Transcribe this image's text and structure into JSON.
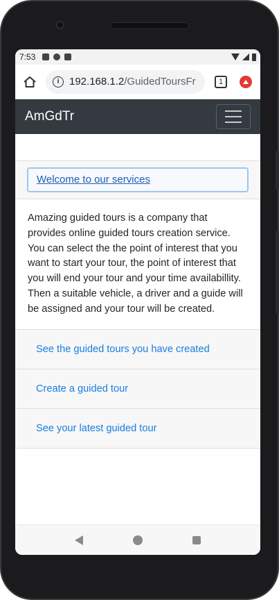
{
  "status_bar": {
    "time": "7:53"
  },
  "browser": {
    "url_host": "192.168.1.2",
    "url_path": "/GuidedToursFr",
    "tab_count": "1"
  },
  "navbar": {
    "brand": "AmGdTr"
  },
  "card": {
    "header_link": "Welcome to our services",
    "body_text": "Amazing guided tours is a company that provides online guided tours creation service. You can select the the point of interest that you want to start your tour, the point of interest that you will end your tour and your time availabillity. Then a suitable vehicle, a driver and a guide will be assigned and your tour will be created.",
    "links": [
      "See the guided tours you have created",
      "Create a guided tour",
      "See your latest guided tour"
    ]
  },
  "colors": {
    "navbar_bg": "#343a40",
    "link": "#1a7de0",
    "header_link": "#1b5fb3"
  }
}
